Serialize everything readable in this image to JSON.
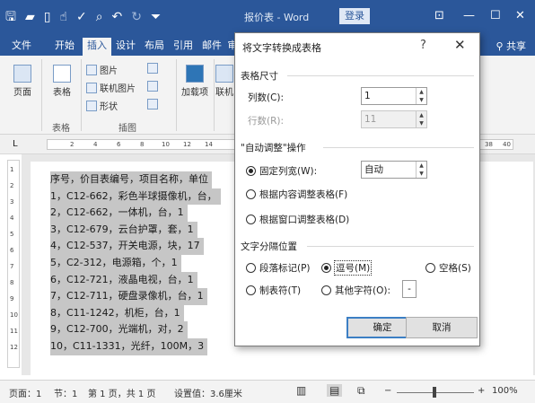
{
  "window": {
    "title": "报价表 - Word",
    "login_label": "登录",
    "restore_icon": "⊡",
    "minimize_icon": "—",
    "maximize_icon": "☐",
    "close_icon": "✕"
  },
  "qat": [
    "save-icon",
    "open-icon",
    "new-icon",
    "touch-icon",
    "spelling-icon",
    "print-preview-icon",
    "undo-icon",
    "redo-icon",
    "customize-icon"
  ],
  "tabs": [
    {
      "label": "文件"
    },
    {
      "label": "开始"
    },
    {
      "label": "插入"
    },
    {
      "label": "设计"
    },
    {
      "label": "布局"
    },
    {
      "label": "引用"
    },
    {
      "label": "邮件"
    },
    {
      "label": "审"
    }
  ],
  "share_label": "共享",
  "ribbon": {
    "page_label": "页面",
    "table_label": "表格",
    "table_group": "表格",
    "picture_label": "图片",
    "online_picture_label": "联机图片",
    "shape_label": "形状",
    "illustration_group": "插图",
    "addin_label": "加载项",
    "link_label": "联机"
  },
  "ruler_ticks": [
    "2",
    "4",
    "6",
    "8",
    "10",
    "12",
    "14",
    "38",
    "40"
  ],
  "vruler_ticks": [
    "1",
    "1",
    "2",
    "3",
    "4",
    "5",
    "6",
    "7",
    "8",
    "9",
    "10",
    "11",
    "12"
  ],
  "doc_lines": [
    "序号，价目表编号，项目名称，单位",
    "1，C12-662，彩色半球摄像机，台，",
    "2，C12-662，一体机，台，1",
    "3，C12-679，云台护罩，套，1",
    "4，C12-537，开关电源，块，17",
    "5，C2-312，电源箱，个，1",
    "6，C12-721，液晶电视，台，1",
    "7，C12-711，硬盘录像机，台，1",
    "8，C11-1242，机柜，台，1",
    "9，C12-700，光端机，对，2",
    "10，C11-1331，光纤，100M，3"
  ],
  "status": {
    "page": "页面：1",
    "section": "节：1",
    "pages": "第 1 页，共 1 页",
    "setting": "设置值：3.6厘米",
    "zoom_minus": "−",
    "zoom_plus": "+",
    "zoom": "100%"
  },
  "dialog": {
    "title": "将文字转换成表格",
    "help": "?",
    "close": "✕",
    "size_section": "表格尺寸",
    "columns_label": "列数(C):",
    "columns_value": "1",
    "rows_label": "行数(R):",
    "rows_value": "11",
    "autofit_section": "\"自动调整\"操作",
    "fixed_width_label": "固定列宽(W):",
    "fixed_width_value": "自动",
    "fit_content_label": "根据内容调整表格(F)",
    "fit_window_label": "根据窗口调整表格(D)",
    "separator_section": "文字分隔位置",
    "paragraph_label": "段落标记(P)",
    "comma_label": "逗号(M)",
    "space_label": "空格(S)",
    "tab_label": "制表符(T)",
    "other_label": "其他字符(O):",
    "other_value": "-",
    "ok_label": "确定",
    "cancel_label": "取消"
  }
}
